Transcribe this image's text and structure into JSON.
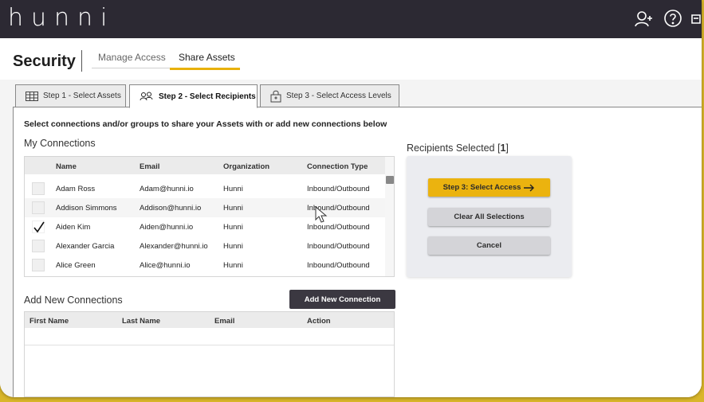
{
  "app": {
    "logo": "hunni"
  },
  "header": {
    "title": "Security",
    "tabs": [
      "Manage Access",
      "Share Assets"
    ],
    "active_tab": "Share Assets"
  },
  "steps": [
    {
      "label": "Step 1 - Select Assets",
      "icon": "grid-icon",
      "active": false
    },
    {
      "label": "Step 2 - Select Recipients",
      "icon": "users-icon",
      "active": true
    },
    {
      "label": "Step 3 - Select Access Levels",
      "icon": "lock-icon",
      "active": false
    }
  ],
  "instructions": "Select connections and/or groups to share your Assets with or add new connections below",
  "connections": {
    "title": "My Connections",
    "columns": [
      "Name",
      "Email",
      "Organization",
      "Connection Type"
    ],
    "rows": [
      {
        "name": "Adam Ross",
        "email": "Adam@hunni.io",
        "org": "Hunni",
        "type": "Inbound/Outbound",
        "checked": false
      },
      {
        "name": "Addison Simmons",
        "email": "Addison@hunni.io",
        "org": "Hunni",
        "type": "Inbound/Outbound",
        "checked": false
      },
      {
        "name": "Aiden Kim",
        "email": "Aiden@hunni.io",
        "org": "Hunni",
        "type": "Inbound/Outbound",
        "checked": true
      },
      {
        "name": "Alexander Garcia",
        "email": "Alexander@hunni.io",
        "org": "Hunni",
        "type": "Inbound/Outbound",
        "checked": false
      },
      {
        "name": "Alice Green",
        "email": "Alice@hunni.io",
        "org": "Hunni",
        "type": "Inbound/Outbound",
        "checked": false
      }
    ]
  },
  "recipients": {
    "label": "Recipients Selected [",
    "count": "1",
    "label_end": "]",
    "buttons": {
      "select_access": "Step 3: Select Access",
      "clear": "Clear All Selections",
      "cancel": "Cancel"
    }
  },
  "add_connections": {
    "title": "Add New Connections",
    "button": "Add New Connection",
    "columns": [
      "First Name",
      "Last Name",
      "Email",
      "Action"
    ]
  },
  "colors": {
    "topbar": "#2c2933",
    "accent": "#ebb30f",
    "frame": "#d9b62a"
  }
}
